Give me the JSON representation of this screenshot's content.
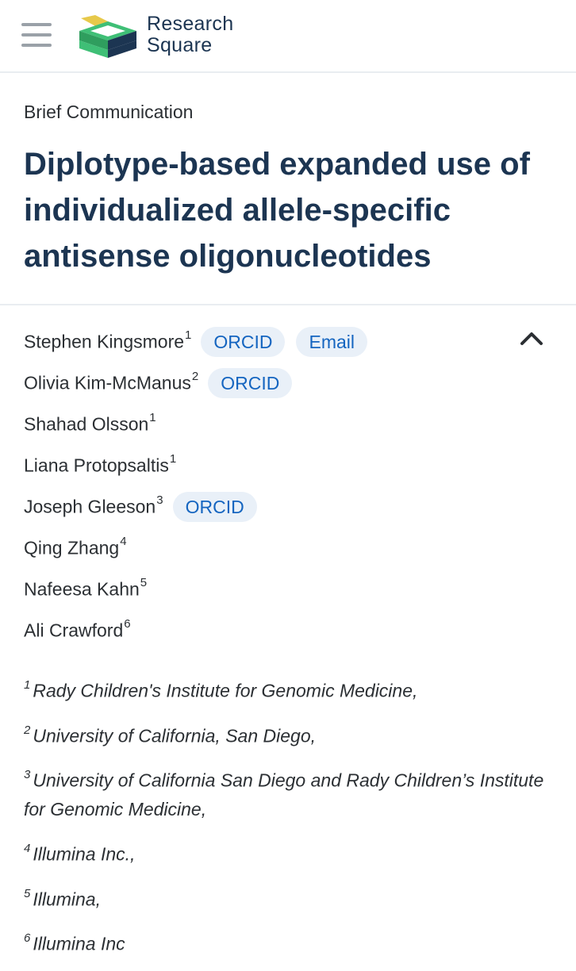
{
  "header": {
    "logo_line1": "Research",
    "logo_line2": "Square",
    "colors": {
      "brand_navy": "#1c3552",
      "logo_green": "#3fbf76",
      "logo_yellow": "#e7c94a",
      "link_blue": "#1565c0"
    }
  },
  "article": {
    "type": "Brief Communication",
    "title": "Diplotype-based expanded use of individualized allele-specific antisense oligonucleotides"
  },
  "authors": [
    {
      "name": "Stephen Kingsmore",
      "sup": "1",
      "orcid": "ORCID",
      "email": "Email"
    },
    {
      "name": "Olivia Kim-McManus",
      "sup": "2",
      "orcid": "ORCID"
    },
    {
      "name": "Shahad Olsson",
      "sup": "1"
    },
    {
      "name": "Liana Protopsaltis",
      "sup": "1"
    },
    {
      "name": "Joseph Gleeson",
      "sup": "3",
      "orcid": "ORCID"
    },
    {
      "name": "Qing Zhang",
      "sup": "4"
    },
    {
      "name": "Nafeesa Kahn",
      "sup": "5"
    },
    {
      "name": "Ali Crawford",
      "sup": "6"
    }
  ],
  "affiliations": [
    {
      "num": "1",
      "text": "Rady Children's Institute for Genomic Medicine,"
    },
    {
      "num": "2",
      "text": "University of California, San Diego,"
    },
    {
      "num": "3",
      "text": "University of California San Diego and Rady Children’s Institute for Genomic Medicine,"
    },
    {
      "num": "4",
      "text": "Illumina Inc.,"
    },
    {
      "num": "5",
      "text": "Illumina,"
    },
    {
      "num": "6",
      "text": "Illumina Inc"
    }
  ],
  "icons": {
    "menu": "hamburger-menu-icon",
    "collapse": "chevron-up-icon",
    "logo": "research-square-logo"
  }
}
